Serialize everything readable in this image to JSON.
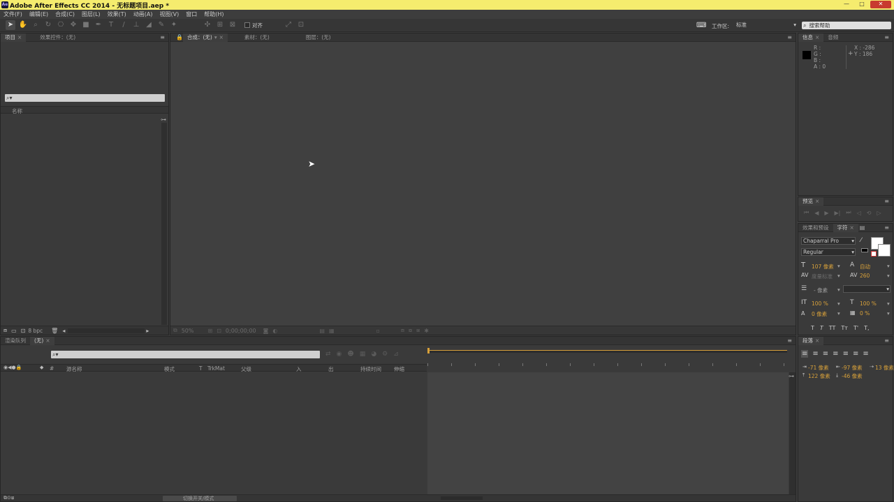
{
  "window": {
    "title": "Adobe After Effects CC 2014 - 无标题项目.aep *",
    "logo": "Ae"
  },
  "menu": [
    "文件(F)",
    "编辑(E)",
    "合成(C)",
    "图层(L)",
    "效果(T)",
    "动画(A)",
    "视图(V)",
    "窗口",
    "帮助(H)"
  ],
  "toolbar": {
    "snap_label": "对齐",
    "workspace_label": "工作区:",
    "workspace_value": "标准",
    "search_placeholder": "搜索帮助"
  },
  "project_panel": {
    "tabs": [
      "项目",
      "效果控件：(无)"
    ],
    "search_placeholder": "",
    "column_name": "名称",
    "bpc": "8 bpc"
  },
  "viewer_panel": {
    "tabs": [
      "合成：(无)",
      "素材：(无)",
      "图层：(无)"
    ],
    "zoom": "50%",
    "timecode": "0;00;00;00"
  },
  "info_panel": {
    "tabs": [
      "信息",
      "音频"
    ],
    "r": "R :",
    "g": "G :",
    "b": "B :",
    "a": "A : 0",
    "x": "X : -286",
    "y": "Y : 186"
  },
  "preview_panel": {
    "tab": "预览"
  },
  "character_panel": {
    "tabs": [
      "效果和预设",
      "字符"
    ],
    "font_family": "Chaparral Pro",
    "font_style": "Regular",
    "font_size": "107 像素",
    "leading": "自动",
    "kerning": "度量标准",
    "tracking": "260",
    "stroke_width": "- 像素",
    "vscale": "100 %",
    "hscale": "100 %",
    "baseline": "0 像素",
    "tsume": "0 %",
    "style_buttons": [
      "T",
      "T",
      "TT",
      "Tт",
      "T'",
      "T,"
    ]
  },
  "paragraph_panel": {
    "tab": "段落",
    "indent_left": "-71 像素",
    "indent_right": "-97 像素",
    "indent_first": "13 像素",
    "space_before": "122 像素",
    "space_after": "-46 像素"
  },
  "timeline": {
    "tabs": [
      "渲染队列",
      "(无)"
    ],
    "columns": [
      "源名称",
      "模式",
      "T",
      "TrkMat",
      "父级",
      "入",
      "出",
      "持续时间",
      "伸缩"
    ],
    "col_hash": "#",
    "footer": "切换开关/模式"
  },
  "colors": {
    "titlebar": "#f5ec6e",
    "panel": "#3a3a3a",
    "accent": "#d8a13a"
  }
}
